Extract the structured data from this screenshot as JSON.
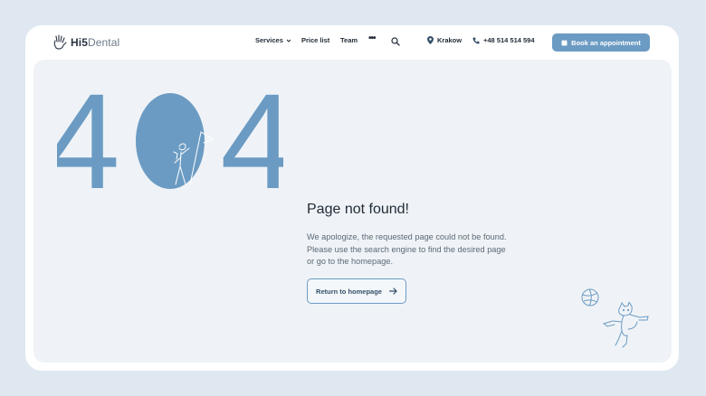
{
  "colors": {
    "accent": "#6b9bc3",
    "background": "#dfe8f1",
    "panel": "#eff3f7",
    "text": "#1f2a36"
  },
  "logo": {
    "part1": "Hi5",
    "part2": "Dental",
    "icon": "hand-logo-icon"
  },
  "nav": {
    "services": "Services",
    "price_list": "Price list",
    "team": "Team",
    "more": "•••",
    "search_icon": "search-icon"
  },
  "contact": {
    "location": "Krakow",
    "phone": "+48 514 514 594"
  },
  "cta": {
    "book": "Book an appointment"
  },
  "error": {
    "code_first": "4",
    "code_last": "4",
    "heading": "Page not found!",
    "line1": "We apologize, the requested page could not be found.",
    "line2": "Please use the search engine to find the desired page",
    "line3": "or go to the homepage.",
    "return_label": "Return to homepage"
  }
}
